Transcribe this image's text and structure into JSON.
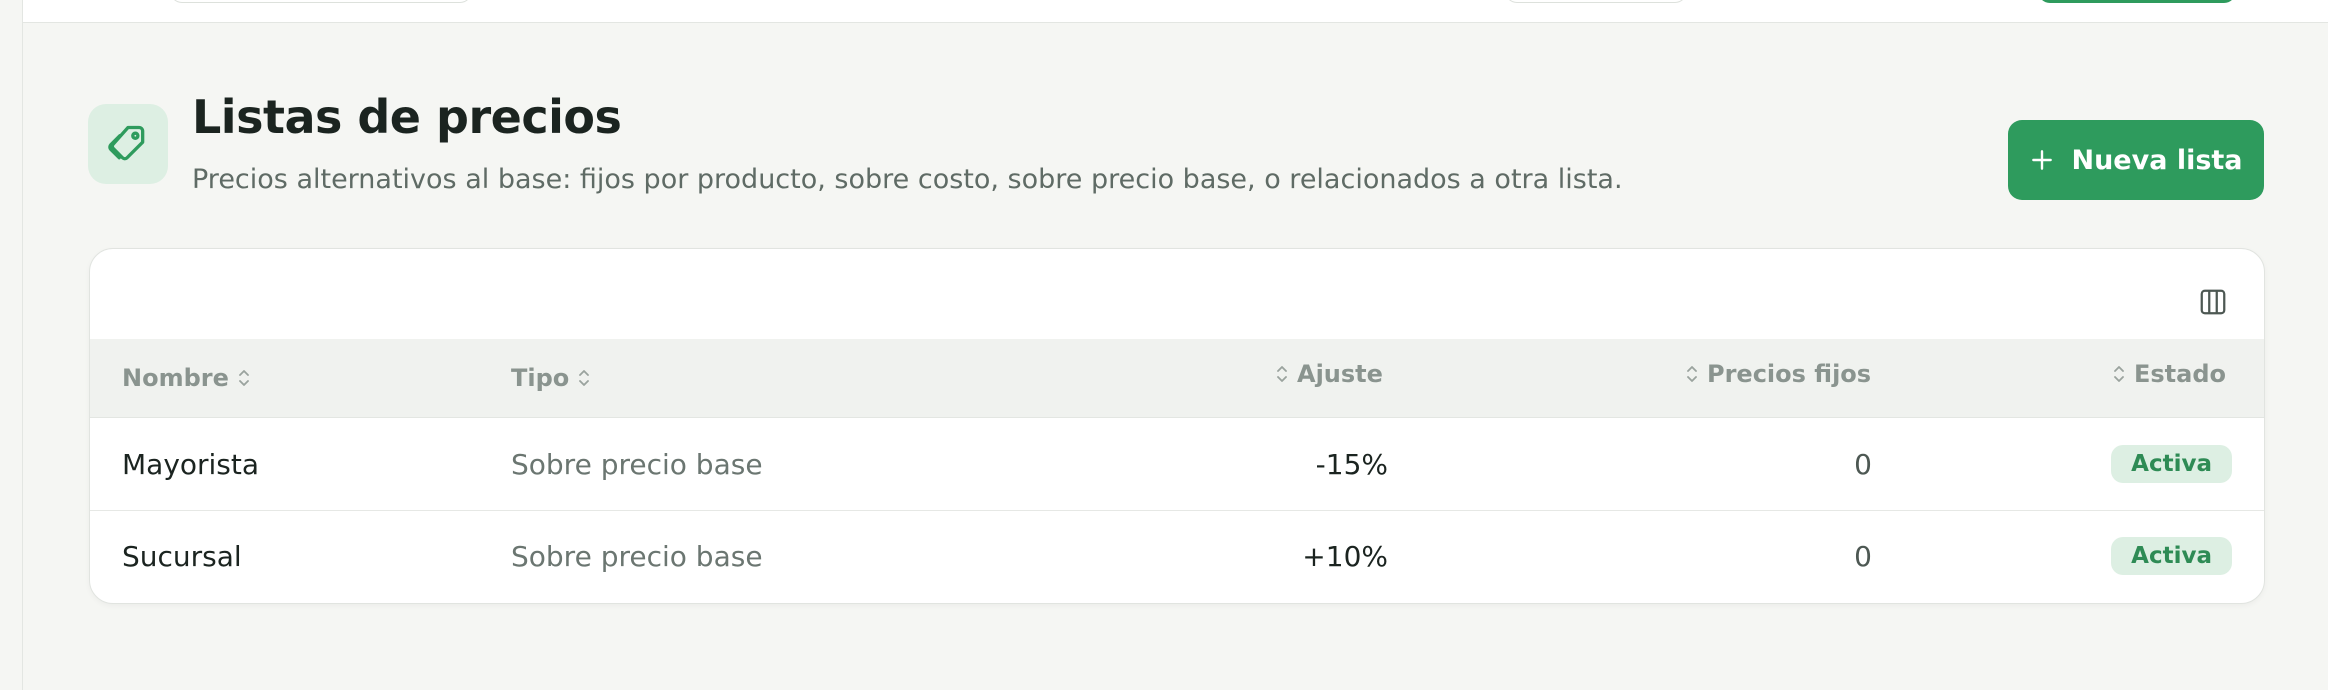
{
  "header": {
    "title": "Listas de precios",
    "subtitle": "Precios alternativos al base: fijos por producto, sobre costo, sobre precio base, o relacionados a otra lista.",
    "icon": "tag-icon",
    "new_button_label": "Nueva lista"
  },
  "table": {
    "columns": {
      "name": "Nombre",
      "type": "Tipo",
      "adjust": "Ajuste",
      "fixed": "Precios fijos",
      "status": "Estado"
    },
    "rows": [
      {
        "name": "Mayorista",
        "type": "Sobre precio base",
        "adjust": "-15%",
        "fixed": "0",
        "status": "Activa"
      },
      {
        "name": "Sucursal",
        "type": "Sobre precio base",
        "adjust": "+10%",
        "fixed": "0",
        "status": "Activa"
      }
    ]
  },
  "colors": {
    "accent": "#2e9b5d",
    "accent_soft": "#ddefe3",
    "background": "#f5f6f3"
  }
}
